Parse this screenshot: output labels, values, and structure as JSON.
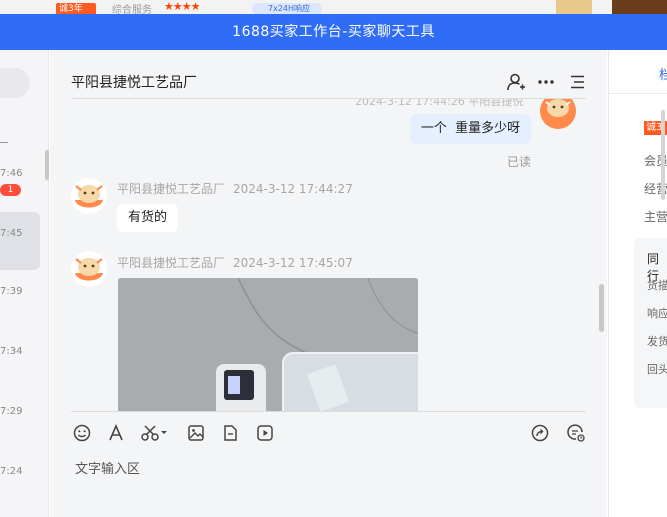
{
  "window": {
    "title": "1688买家工作台-买家聊天工具"
  },
  "background_page": {
    "badge": "诚3年",
    "text": "综合服务",
    "stars": "★★★★",
    "pill": "7x24H响应"
  },
  "conversations": [
    {
      "time": "7:46",
      "badge": "1",
      "active": false
    },
    {
      "time": "7:45",
      "active": true
    },
    {
      "time": "7:39"
    },
    {
      "time": "7:34"
    },
    {
      "time": "7:29"
    },
    {
      "time": "7:24"
    }
  ],
  "chat": {
    "title": "平阳县捷悦工艺品厂",
    "header_icons": [
      "user-add-icon",
      "more-icon",
      "list-icon"
    ],
    "cut_meta": "2024-3-12 17:44:26  平阳县捷悦",
    "messages": [
      {
        "direction": "out",
        "text": "一个  重量多少呀",
        "status": "已读"
      },
      {
        "direction": "in",
        "sender": "平阳县捷悦工艺品厂",
        "time": "2024-3-12 17:44:27",
        "text": "有货的"
      },
      {
        "direction": "in",
        "sender": "平阳县捷悦工艺品厂",
        "time": "2024-3-12 17:45:07",
        "type": "image"
      }
    ],
    "toolbar_icons": [
      "emoji-icon",
      "font-icon",
      "scissors-icon",
      "image-icon",
      "file-icon",
      "video-icon",
      "share-icon",
      "history-icon"
    ],
    "compose_placeholder": "文字输入区"
  },
  "right_panel": {
    "tab": "档",
    "badge": "诚3",
    "rows": [
      "会员",
      "经营",
      "主营"
    ],
    "box_title": "同行",
    "box_rows": [
      "货描",
      "响应",
      "发货",
      "回头"
    ]
  },
  "colors": {
    "brand_blue": "#2f6df6",
    "badge_red": "#ff4d3c",
    "bubble_out": "#e6efff"
  }
}
